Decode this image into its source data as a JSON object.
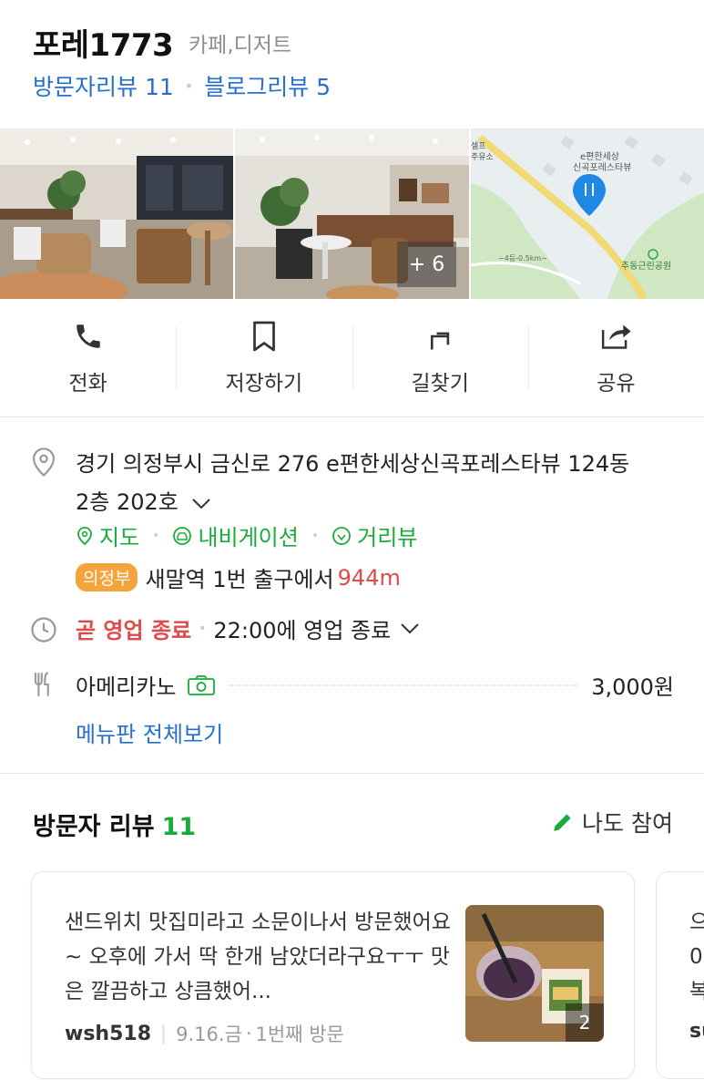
{
  "place": {
    "name": "포레1773",
    "category": "카페,디저트",
    "visitor_reviews": "방문자리뷰 11",
    "blog_reviews": "블로그리뷰 5"
  },
  "photos": {
    "more_count": "+ 6",
    "map_labels": [
      "e편한세상",
      "신곡포레스타뷰",
      "추동근린공원",
      "셀프",
      "주유소",
      "~4등-0.5km~"
    ]
  },
  "actions": [
    {
      "label": "전화",
      "icon": "phone-icon"
    },
    {
      "label": "저장하기",
      "icon": "bookmark-icon"
    },
    {
      "label": "길찾기",
      "icon": "directions-icon"
    },
    {
      "label": "공유",
      "icon": "share-icon"
    }
  ],
  "info": {
    "address_line1": "경기 의정부시 금신로 276 e편한세상신곡포레스타뷰 124동",
    "address_line2": "2층 202호",
    "map_link": "지도",
    "navi_link": "내비게이션",
    "street_link": "거리뷰",
    "line_badge": "의정부",
    "station": "새말역",
    "station_exit": "1번 출구에서",
    "distance": "944m",
    "status": "곧 영업 종료",
    "hours": "22:00에 영업 종료",
    "menu_item": "아메리카노",
    "menu_price": "3,000원",
    "menu_link": "메뉴판 전체보기"
  },
  "reviews": {
    "title": "방문자 리뷰",
    "count": "11",
    "write_label": "나도 참여",
    "card": {
      "text": "샌드위치 맛집미라고 소문이나서 방문했어요~ 오후에 가서 딱 한개 남았더라구요ㅜㅜ 맛은 깔끔하고 상큼했어...",
      "user": "wsh518",
      "date": "9.16.금",
      "visit": "1번째 방문",
      "photo_count": "2"
    },
    "card2": {
      "text": "으\n0\n복",
      "user": "su"
    }
  },
  "colors": {
    "link_blue": "#2770c9",
    "green": "#1aab3b",
    "red": "#e14a4a",
    "badge_orange": "#f4a43a"
  }
}
